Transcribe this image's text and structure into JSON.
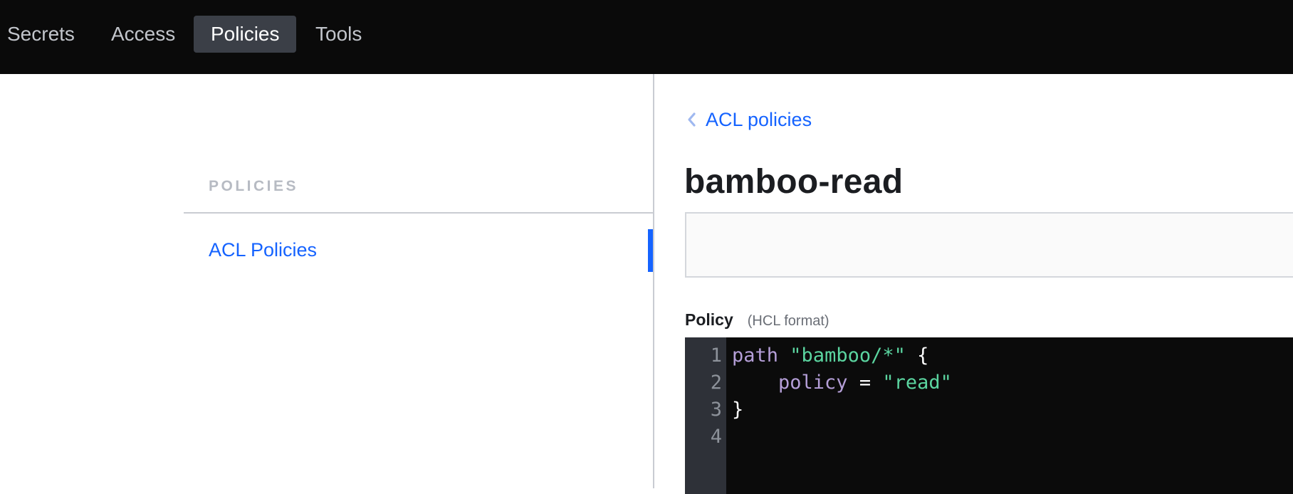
{
  "nav": {
    "items": [
      {
        "label": "Secrets",
        "active": false
      },
      {
        "label": "Access",
        "active": false
      },
      {
        "label": "Policies",
        "active": true
      },
      {
        "label": "Tools",
        "active": false
      }
    ]
  },
  "sidebar": {
    "heading": "POLICIES",
    "items": [
      {
        "label": "ACL Policies",
        "active": true
      }
    ]
  },
  "breadcrumb": {
    "icon": "chevron-left-icon",
    "label": "ACL policies"
  },
  "policy": {
    "name": "bamboo-read",
    "label": "Policy",
    "format_hint": "(HCL format)",
    "code_lines": [
      {
        "number": "1",
        "tokens": [
          {
            "t": "path",
            "c": "kw"
          },
          {
            "t": " ",
            "c": "punc"
          },
          {
            "t": "\"bamboo/*\"",
            "c": "str"
          },
          {
            "t": " {",
            "c": "punc"
          }
        ]
      },
      {
        "number": "2",
        "tokens": [
          {
            "t": "    ",
            "c": "punc"
          },
          {
            "t": "policy",
            "c": "kw"
          },
          {
            "t": " = ",
            "c": "punc"
          },
          {
            "t": "\"read\"",
            "c": "str"
          }
        ]
      },
      {
        "number": "3",
        "tokens": [
          {
            "t": "}",
            "c": "punc"
          }
        ]
      },
      {
        "number": "4",
        "tokens": []
      }
    ]
  },
  "colors": {
    "accent": "#1563ff",
    "topbar": "#0a0a0a",
    "keyword": "#b59fd8",
    "string": "#5bd5a0"
  }
}
